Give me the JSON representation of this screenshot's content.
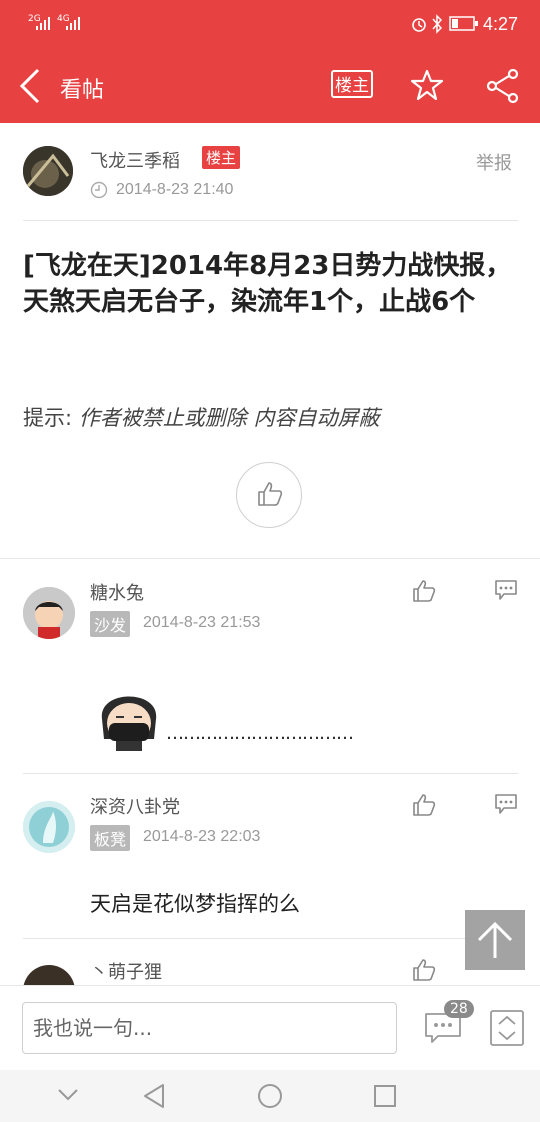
{
  "status_bar": {
    "signal1": "2G",
    "signal2": "4G",
    "time": "4:27"
  },
  "app_bar": {
    "title": "看帖",
    "louzhu_label": "楼主"
  },
  "post": {
    "author": "飞龙三季稻",
    "author_badge": "楼主",
    "time": "2014-8-23 21:40",
    "report": "举报",
    "title": "[飞龙在天]2014年8月23日势力战快报，天煞天启无台子，染流年1个，止战6个",
    "tip_label": "提示:",
    "tip_text": "作者被禁止或删除 内容自动屏蔽"
  },
  "replies": [
    {
      "name": "糖水兔",
      "badge": "沙发",
      "time": "2014-8-23 21:53",
      "content": "……………………………"
    },
    {
      "name": "深资八卦党",
      "badge": "板凳",
      "time": "2014-8-23 22:03",
      "content": "天启是花似梦指挥的么"
    },
    {
      "name": "丶萌子狸"
    }
  ],
  "bottom_bar": {
    "placeholder": "我也说一句...",
    "comment_count": "28"
  },
  "colors": {
    "brand": "#e84142"
  }
}
